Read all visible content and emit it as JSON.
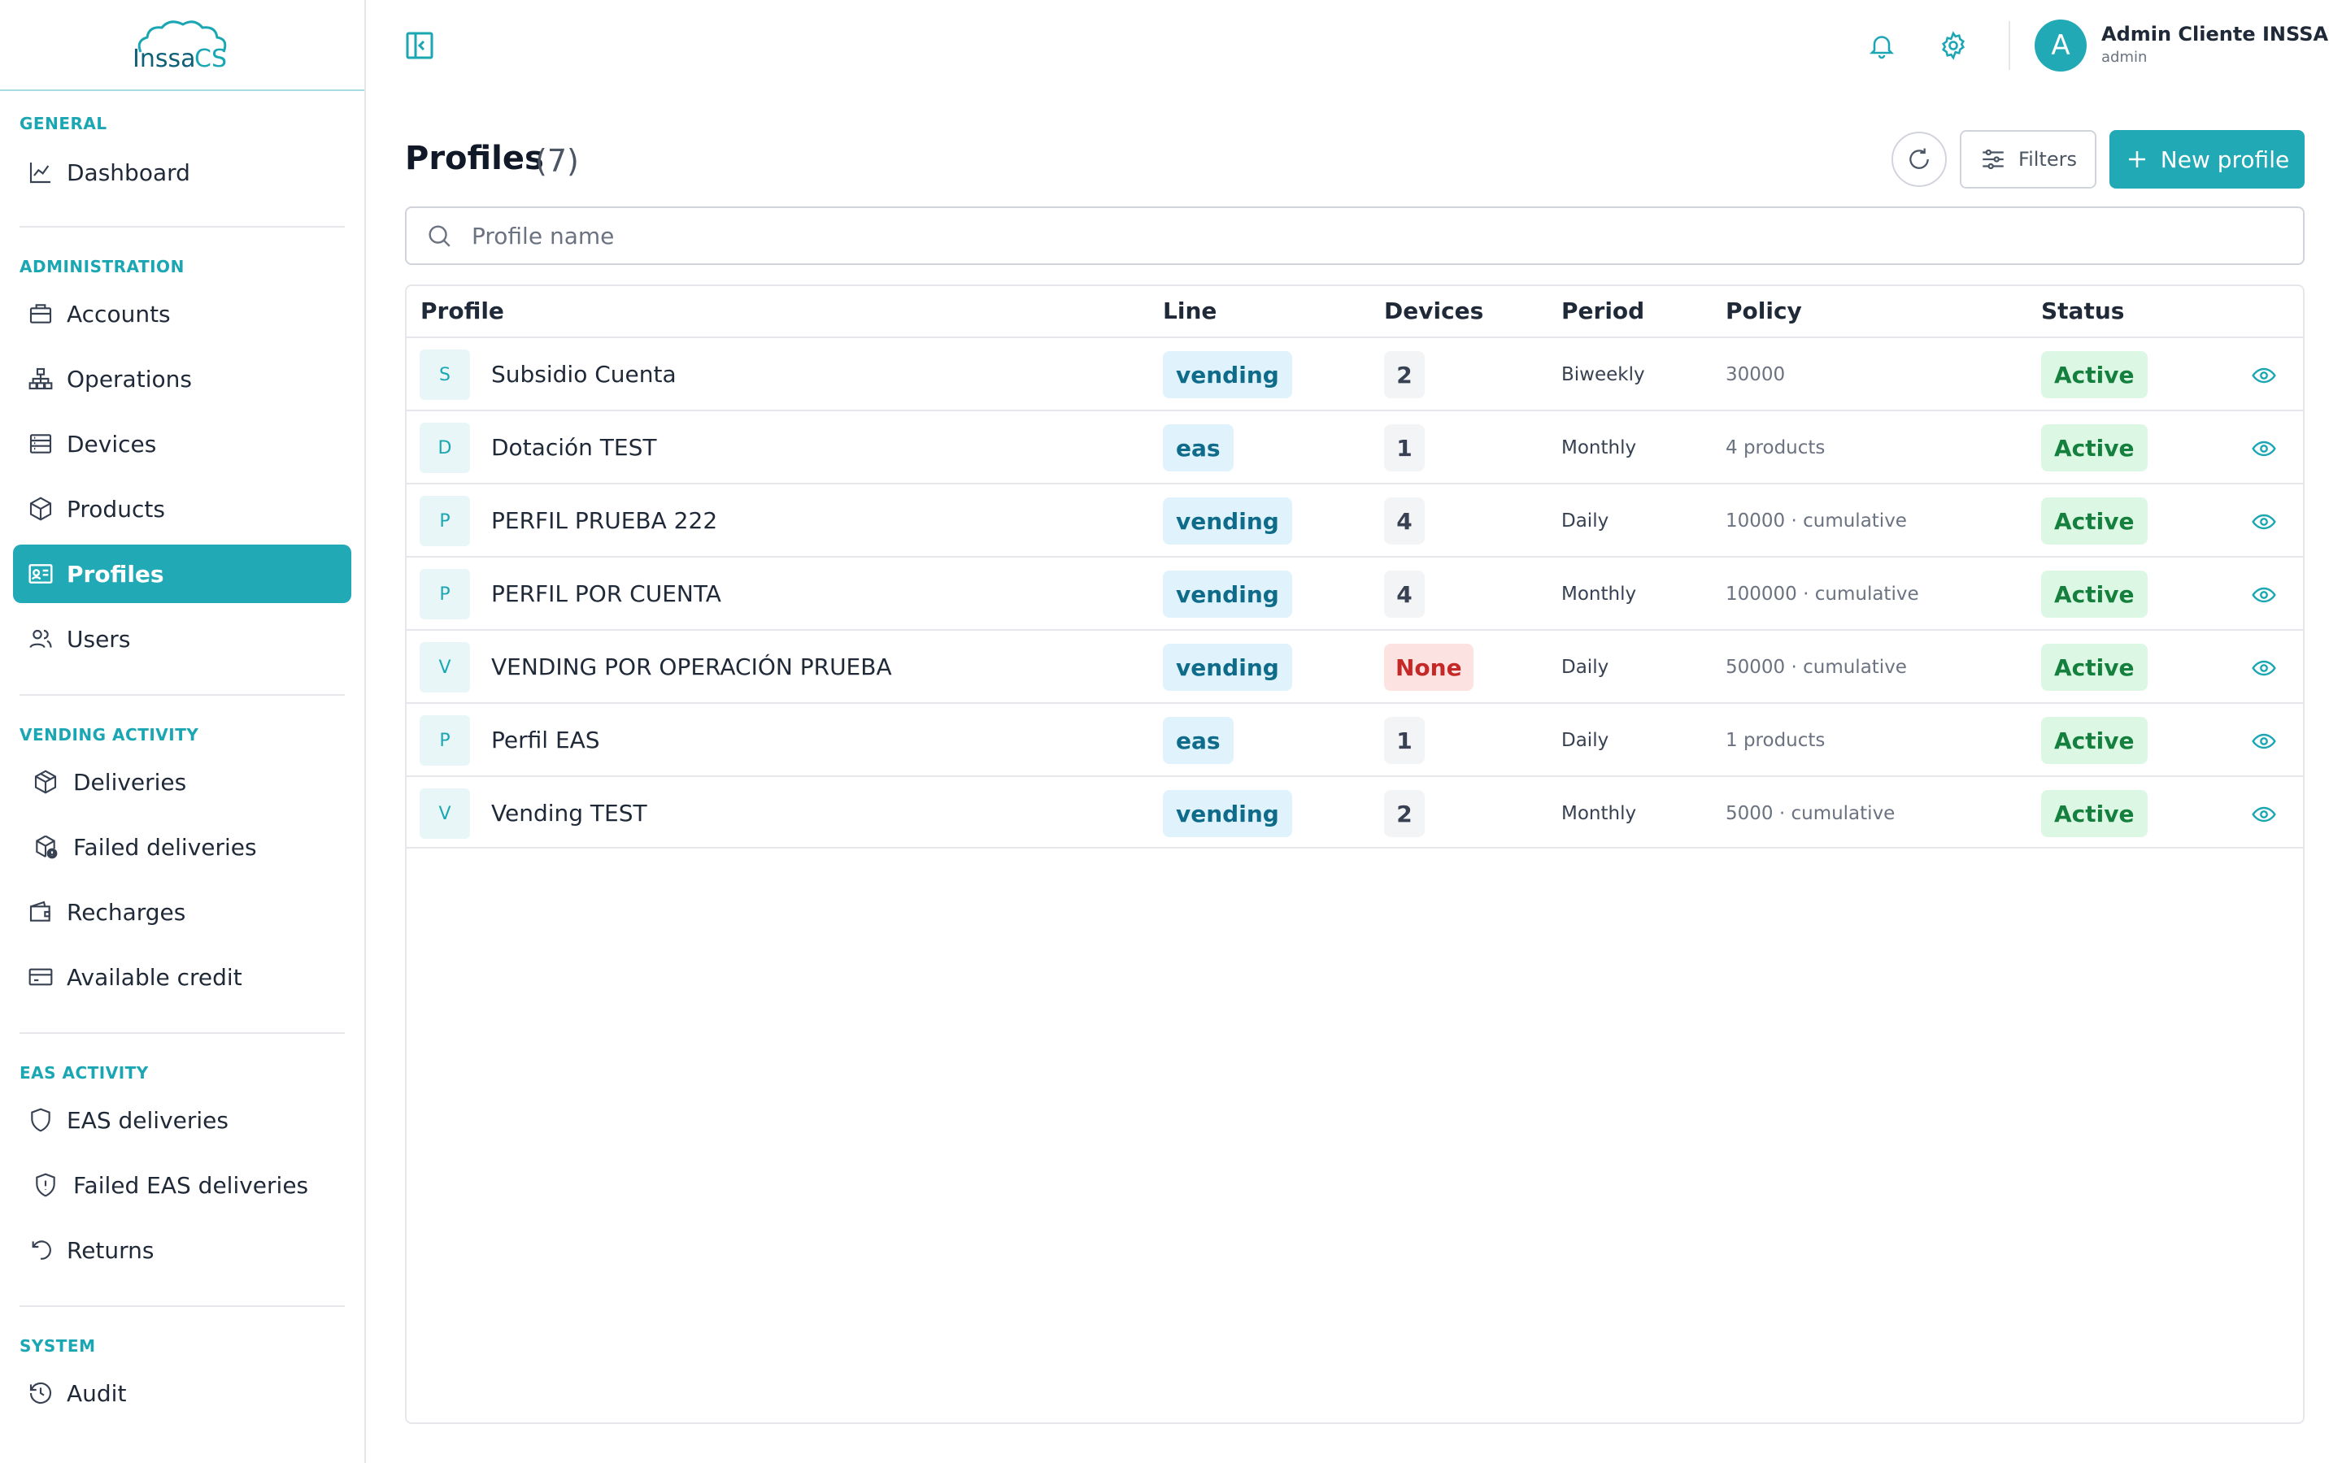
{
  "brand": {
    "logo_text_left": "Inssa",
    "logo_text_right": "CS",
    "accent": "#21a9b6"
  },
  "sidebar": {
    "sections": [
      {
        "title": "GENERAL"
      },
      {
        "title": "ADMINISTRATION"
      },
      {
        "title": "VENDING ACTIVITY"
      },
      {
        "title": "EAS ACTIVITY"
      },
      {
        "title": "SYSTEM"
      }
    ],
    "items": [
      {
        "label": "Dashboard",
        "icon": "chart-line-icon"
      },
      {
        "label": "Accounts",
        "icon": "briefcase-icon"
      },
      {
        "label": "Operations",
        "icon": "network-icon"
      },
      {
        "label": "Devices",
        "icon": "server-icon"
      },
      {
        "label": "Products",
        "icon": "box-icon"
      },
      {
        "label": "Profiles",
        "icon": "id-card-icon",
        "active": true
      },
      {
        "label": "Users",
        "icon": "users-icon"
      },
      {
        "label": "Deliveries",
        "icon": "package-icon"
      },
      {
        "label": "Failed deliveries",
        "icon": "package-alert-icon"
      },
      {
        "label": "Recharges",
        "icon": "wallet-icon"
      },
      {
        "label": "Available credit",
        "icon": "credit-card-icon"
      },
      {
        "label": "EAS deliveries",
        "icon": "shield-icon"
      },
      {
        "label": "Failed EAS deliveries",
        "icon": "shield-alert-icon"
      },
      {
        "label": "Returns",
        "icon": "undo-icon"
      },
      {
        "label": "Audit",
        "icon": "history-icon"
      }
    ]
  },
  "header": {
    "user_initial": "A",
    "user_name": "Admin Cliente INSSA",
    "user_role": "admin"
  },
  "page": {
    "title": "Profiles",
    "count": "(7)",
    "filters_label": "Filters",
    "new_label": "New profile",
    "search_placeholder": "Profile name"
  },
  "table": {
    "columns": [
      "Profile",
      "Line",
      "Devices",
      "Period",
      "Policy",
      "Status"
    ],
    "rows": [
      {
        "initial": "S",
        "name": "Subsidio Cuenta",
        "line": "vending",
        "devices": "2",
        "period": "Biweekly",
        "policy": "30000",
        "status": "Active"
      },
      {
        "initial": "D",
        "name": "Dotación TEST",
        "line": "eas",
        "devices": "1",
        "period": "Monthly",
        "policy": "4 products",
        "status": "Active"
      },
      {
        "initial": "P",
        "name": "PERFIL PRUEBA 222",
        "line": "vending",
        "devices": "4",
        "period": "Daily",
        "policy": "10000 · cumulative",
        "status": "Active"
      },
      {
        "initial": "P",
        "name": "PERFIL POR CUENTA",
        "line": "vending",
        "devices": "4",
        "period": "Monthly",
        "policy": "100000 · cumulative",
        "status": "Active"
      },
      {
        "initial": "V",
        "name": "VENDING POR OPERACIÓN PRUEBA",
        "line": "vending",
        "devices": "None",
        "period": "Daily",
        "policy": "50000 · cumulative",
        "status": "Active"
      },
      {
        "initial": "P",
        "name": "Perfil EAS",
        "line": "eas",
        "devices": "1",
        "period": "Daily",
        "policy": "1 products",
        "status": "Active"
      },
      {
        "initial": "V",
        "name": "Vending TEST",
        "line": "vending",
        "devices": "2",
        "period": "Monthly",
        "policy": "5000 · cumulative",
        "status": "Active"
      }
    ]
  }
}
